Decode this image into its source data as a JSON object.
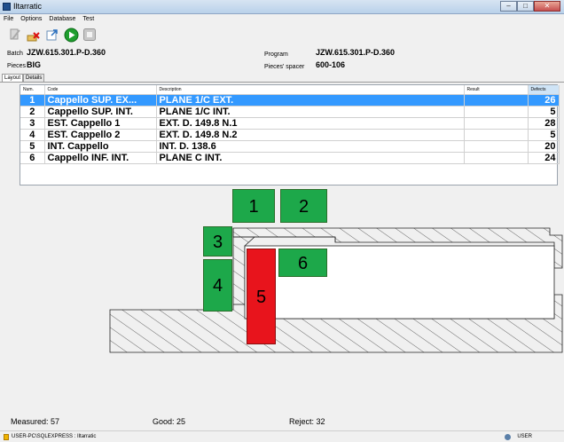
{
  "window": {
    "title": "Iltarratic",
    "minimize_glyph": "–",
    "maximize_glyph": "□",
    "close_glyph": "✕"
  },
  "menu": {
    "items": [
      "File",
      "Options",
      "Database",
      "Test"
    ]
  },
  "toolbar": {
    "buttons": [
      "edit-icon",
      "clear-icon",
      "export-icon",
      "run-icon",
      "stop-icon"
    ],
    "run_color": "#1e9e2e"
  },
  "header": {
    "batch_label": "Batch",
    "batch_value": "JZW.615.301.P-D.360",
    "pieces_label": "Pieces",
    "pieces_value": "BIG",
    "program_label": "Program",
    "program_value": "JZW.615.301.P-D.360",
    "spacer_label": "Pieces' spacer",
    "spacer_value": "600-106"
  },
  "tabs": [
    "Layout",
    "Details"
  ],
  "table": {
    "columns": [
      "Num.",
      "Code",
      "Description",
      "",
      "Result",
      "Defects"
    ],
    "rows": [
      {
        "num": "1",
        "code": "Cappello SUP. EX...",
        "description": "PLANE 1/C EXT.",
        "result": "",
        "defects": "26"
      },
      {
        "num": "2",
        "code": "Cappello SUP. INT.",
        "description": "PLANE 1/C INT.",
        "result": "",
        "defects": "5"
      },
      {
        "num": "3",
        "code": "EST. Cappello 1",
        "description": "EXT. D. 149.8 N.1",
        "result": "",
        "defects": "28"
      },
      {
        "num": "4",
        "code": "EST. Cappello 2",
        "description": "EXT. D. 149.8 N.2",
        "result": "",
        "defects": "5"
      },
      {
        "num": "5",
        "code": "INT. Cappello",
        "description": "INT. D. 138.6",
        "result": "",
        "defects": "20"
      },
      {
        "num": "6",
        "code": "Cappello INF. INT.",
        "description": "PLANE C INT.",
        "result": "",
        "defects": "24"
      }
    ],
    "selected_row": "1",
    "selection_color": "#3399ff"
  },
  "zones": [
    {
      "label": "1",
      "status": "good"
    },
    {
      "label": "2",
      "status": "good"
    },
    {
      "label": "3",
      "status": "good"
    },
    {
      "label": "4",
      "status": "good"
    },
    {
      "label": "5",
      "status": "reject"
    },
    {
      "label": "6",
      "status": "good"
    }
  ],
  "colors": {
    "good": "#1da84a",
    "reject": "#e8141c"
  },
  "summary": {
    "measured": "Measured: 57",
    "good": "Good: 25",
    "reject": "Reject: 32"
  },
  "statusbar": {
    "path": "USER-PC\\SQLEXPRESS : Iltarratic",
    "user": "USER"
  }
}
